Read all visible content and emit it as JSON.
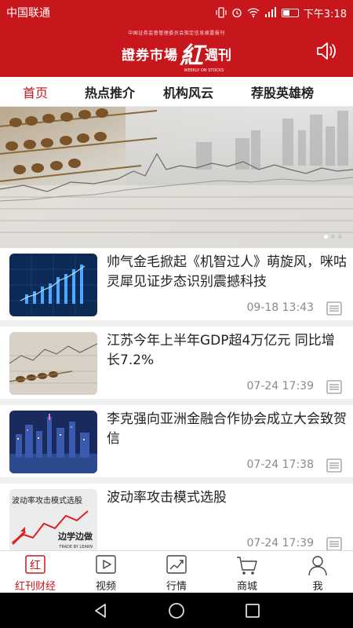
{
  "status_bar": {
    "carrier": "中国联通",
    "time": "下午3:18"
  },
  "header": {
    "logo_top": "中国证券监督管理委员会指定信息披露报刊",
    "logo_a": "證券市場",
    "logo_b": "紅",
    "logo_c": "週刊",
    "logo_sub": "WEEKLY ON STOCKS",
    "speaker_icon": "speaker-icon"
  },
  "tabs": [
    "首页",
    "热点推介",
    "机构风云",
    "荐股英雄榜"
  ],
  "banner": {
    "page_count": 3,
    "active_index": 0
  },
  "news": [
    {
      "title": "帅气金毛掀起《机智过人》萌旋风，咪咕灵犀见证步态识别震撼科技",
      "time": "09-18 13:43"
    },
    {
      "title": "江苏今年上半年GDP超4万亿元 同比增长7.2%",
      "time": "07-24 17:39"
    },
    {
      "title": "李克强向亚洲金融合作协会成立大会致贺信",
      "time": "07-24 17:38"
    },
    {
      "title": "波动率攻击模式选股",
      "time": "07-24 17:39",
      "thumb_title": "波动率攻击模式选股",
      "thumb_caption": "边学边做",
      "thumb_caption_sub": "TRADE BY LEARN"
    }
  ],
  "tabbar": [
    {
      "label": "红刊财经",
      "icon": "hongkan-icon",
      "glyph": "红"
    },
    {
      "label": "视频",
      "icon": "video-icon"
    },
    {
      "label": "行情",
      "icon": "market-chart-icon"
    },
    {
      "label": "商城",
      "icon": "shopping-cart-icon"
    },
    {
      "label": "我",
      "icon": "user-icon"
    }
  ],
  "colors": {
    "brand": "#c8161d"
  }
}
